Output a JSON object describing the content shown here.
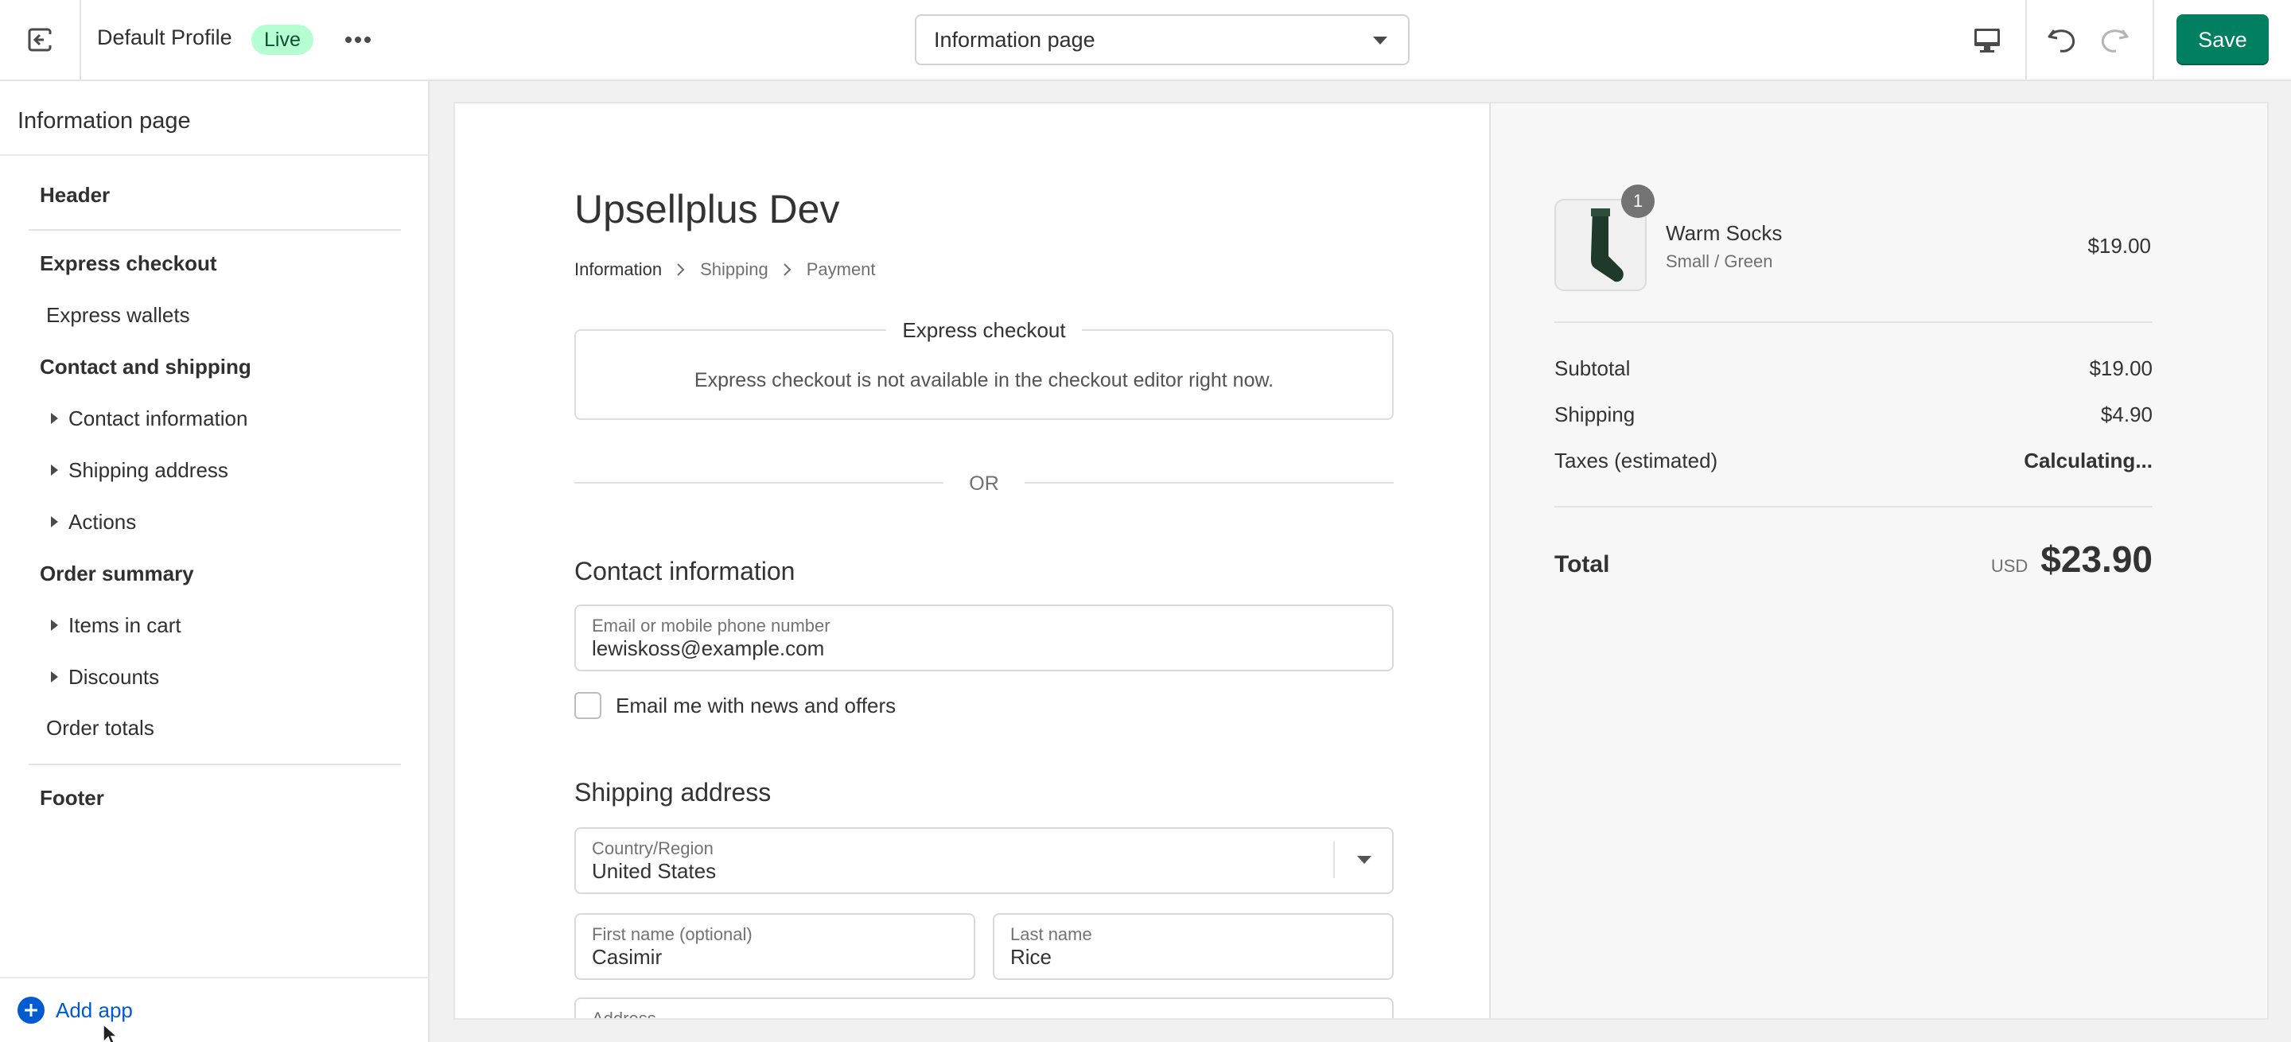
{
  "topbar": {
    "profile_name": "Default Profile",
    "status_badge": "Live",
    "page_select": "Information page",
    "save_label": "Save"
  },
  "sidebar": {
    "title": "Information page",
    "items": [
      {
        "label": "Header"
      },
      {
        "label": "Express checkout"
      },
      {
        "label": "Express wallets"
      },
      {
        "label": "Contact and shipping"
      },
      {
        "label": "Contact information"
      },
      {
        "label": "Shipping address"
      },
      {
        "label": "Actions"
      },
      {
        "label": "Order summary"
      },
      {
        "label": "Items in cart"
      },
      {
        "label": "Discounts"
      },
      {
        "label": "Order totals"
      },
      {
        "label": "Footer"
      }
    ],
    "add_app": "Add app"
  },
  "checkout": {
    "shop_title": "Upsellplus Dev",
    "breadcrumb": [
      "Information",
      "Shipping",
      "Payment"
    ],
    "express_title": "Express checkout",
    "express_note": "Express checkout is not available in the checkout editor right now.",
    "or_text": "OR",
    "contact_heading": "Contact information",
    "email_label": "Email or mobile phone number",
    "email_value": "lewiskoss@example.com",
    "newsletter_label": "Email me with news and offers",
    "shipping_heading": "Shipping address",
    "country_label": "Country/Region",
    "country_value": "United States",
    "first_name_label": "First name (optional)",
    "first_name_value": "Casimir",
    "last_name_label": "Last name",
    "last_name_value": "Rice",
    "address_label": "Address"
  },
  "summary": {
    "product_name": "Warm Socks",
    "product_variant": "Small / Green",
    "product_price": "$19.00",
    "quantity": "1",
    "subtotal_label": "Subtotal",
    "subtotal_value": "$19.00",
    "shipping_label": "Shipping",
    "shipping_value": "$4.90",
    "taxes_label": "Taxes (estimated)",
    "taxes_value": "Calculating...",
    "total_label": "Total",
    "currency": "USD",
    "total_value": "$23.90"
  },
  "colors": {
    "primary": "#008060",
    "link": "#005bd3",
    "badge_bg": "#b4fed2"
  }
}
